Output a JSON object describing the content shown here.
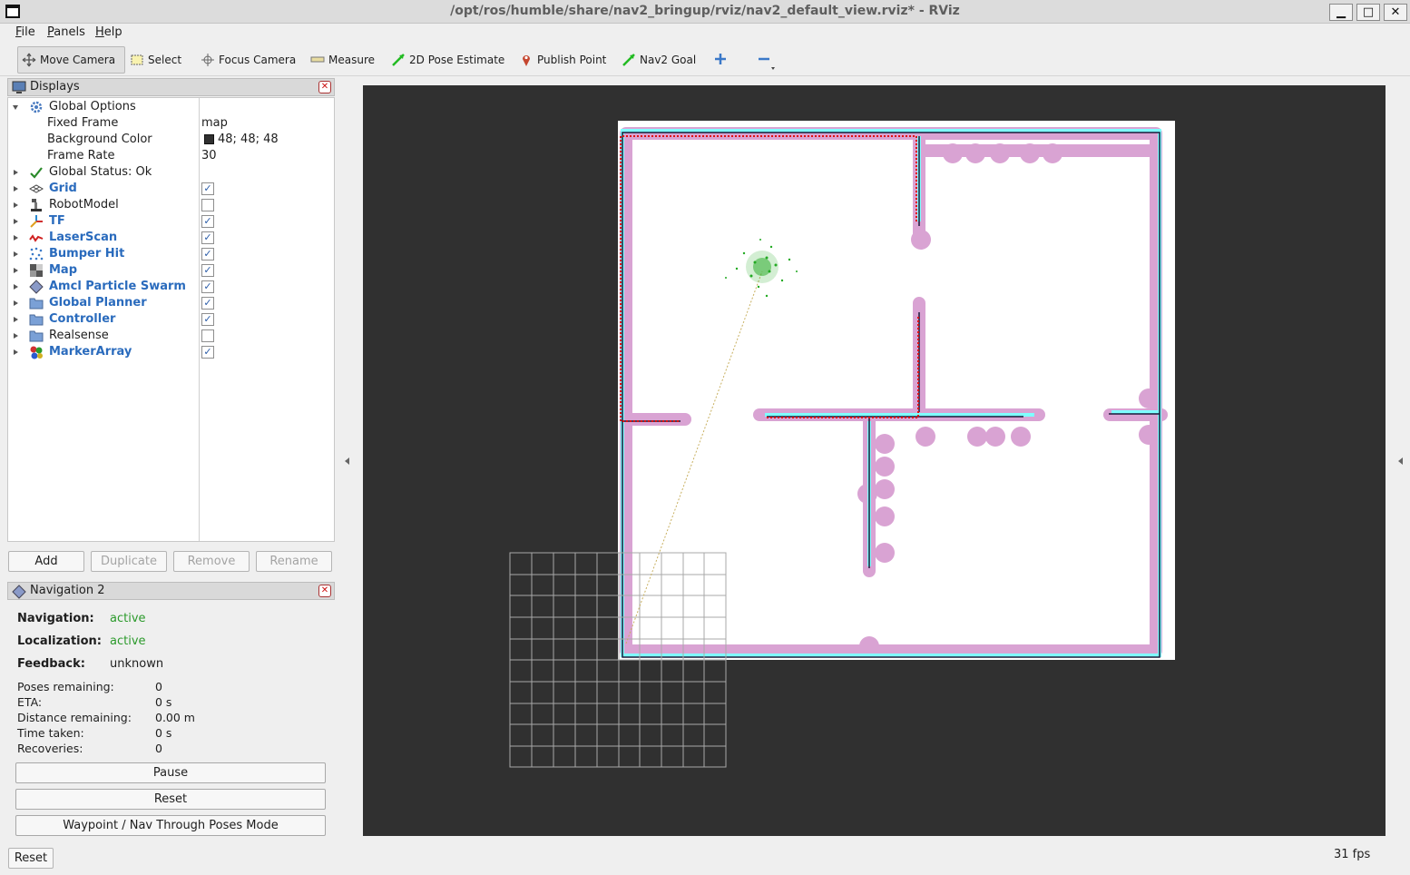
{
  "window": {
    "title": "/opt/ros/humble/share/nav2_bringup/rviz/nav2_default_view.rviz* - RViz",
    "buttons": {
      "minimize": "▁",
      "maximize": "□",
      "close": "✕"
    }
  },
  "menu": {
    "items": [
      {
        "label": "File",
        "underline": "F",
        "rest": "ile"
      },
      {
        "label": "Panels",
        "underline": "P",
        "rest": "anels"
      },
      {
        "label": "Help",
        "underline": "H",
        "rest": "elp"
      }
    ]
  },
  "toolbar": {
    "tools": [
      {
        "label": "Move Camera",
        "icon": "move-camera-icon",
        "active": true
      },
      {
        "label": "Select",
        "icon": "select-icon"
      },
      {
        "label": "Focus Camera",
        "icon": "focus-camera-icon"
      },
      {
        "label": "Measure",
        "icon": "measure-icon"
      },
      {
        "label": "2D Pose Estimate",
        "icon": "pose-estimate-icon"
      },
      {
        "label": "Publish Point",
        "icon": "publish-point-icon"
      },
      {
        "label": "Nav2 Goal",
        "icon": "nav2-goal-icon"
      }
    ],
    "add_tool_icon": "plus-icon",
    "remove_tool_icon": "minus-icon"
  },
  "displays_panel": {
    "title": "Displays",
    "global_options": {
      "label": "Global Options",
      "fixed_frame": {
        "label": "Fixed Frame",
        "value": "map"
      },
      "background_color": {
        "label": "Background Color",
        "value": "48; 48; 48",
        "swatch": "#303030"
      },
      "frame_rate": {
        "label": "Frame Rate",
        "value": "30"
      }
    },
    "global_status": "Global Status: Ok",
    "items": [
      {
        "label": "Grid",
        "checked": true,
        "enabled": true,
        "icon": "grid-icon"
      },
      {
        "label": "RobotModel",
        "checked": false,
        "enabled": false,
        "icon": "robot-model-icon"
      },
      {
        "label": "TF",
        "checked": true,
        "enabled": true,
        "icon": "tf-icon"
      },
      {
        "label": "LaserScan",
        "checked": true,
        "enabled": true,
        "icon": "laserscan-icon"
      },
      {
        "label": "Bumper Hit",
        "checked": true,
        "enabled": true,
        "icon": "bumper-hit-icon"
      },
      {
        "label": "Map",
        "checked": true,
        "enabled": true,
        "icon": "map-icon"
      },
      {
        "label": "Amcl Particle Swarm",
        "checked": true,
        "enabled": true,
        "icon": "particle-swarm-icon"
      },
      {
        "label": "Global Planner",
        "checked": true,
        "enabled": true,
        "icon": "folder-icon"
      },
      {
        "label": "Controller",
        "checked": true,
        "enabled": true,
        "icon": "folder-icon"
      },
      {
        "label": "Realsense",
        "checked": false,
        "enabled": false,
        "icon": "folder-icon"
      },
      {
        "label": "MarkerArray",
        "checked": true,
        "enabled": true,
        "icon": "marker-array-icon"
      }
    ],
    "check_mark": "✓",
    "buttons": {
      "add": "Add",
      "duplicate": "Duplicate",
      "remove": "Remove",
      "rename": "Rename"
    }
  },
  "navigation_panel": {
    "title": "Navigation 2",
    "navigation": {
      "label": "Navigation:",
      "value": "active"
    },
    "localization": {
      "label": "Localization:",
      "value": "active"
    },
    "feedback": {
      "label": "Feedback:",
      "value": "unknown"
    },
    "stats": [
      {
        "label": "Poses remaining:",
        "value": "0"
      },
      {
        "label": "ETA:",
        "value": "0 s"
      },
      {
        "label": "Distance remaining:",
        "value": "0.00 m"
      },
      {
        "label": "Time taken:",
        "value": "0 s"
      },
      {
        "label": "Recoveries:",
        "value": "0"
      }
    ],
    "buttons": {
      "pause": "Pause",
      "reset": "Reset",
      "waypoint": "Waypoint / Nav Through Poses Mode"
    }
  },
  "status_bar": {
    "reset": "Reset",
    "fps": "31 fps"
  },
  "colors": {
    "viewport_bg": "#303030",
    "active_green": "#2b9a2b",
    "display_blue": "#2a6bbd",
    "costmap_pink": "#d9a3d3",
    "costmap_cyan": "#7fffff"
  }
}
